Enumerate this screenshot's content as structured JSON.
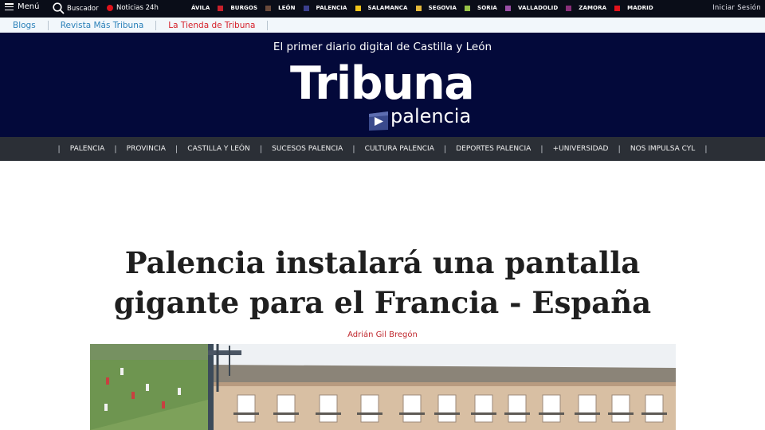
{
  "topbar": {
    "menu_label": "Menú",
    "search_label": "Buscador",
    "news24_label": "Noticias 24h",
    "login_label": "Iniciar Sesión",
    "cities": [
      {
        "label": "ÁVILA",
        "color": "#c8202b"
      },
      {
        "label": "BURGOS",
        "color": "#6a4a3a"
      },
      {
        "label": "LEÓN",
        "color": "#3b3f8f"
      },
      {
        "label": "PALENCIA",
        "color": "#f0c419"
      },
      {
        "label": "SALAMANCA",
        "color": "#e5b93a"
      },
      {
        "label": "SEGOVIA",
        "color": "#97c247"
      },
      {
        "label": "SORIA",
        "color": "#9a4fa6"
      },
      {
        "label": "VALLADOLID",
        "color": "#8a2f7a"
      },
      {
        "label": "ZAMORA",
        "color": "#e2121b"
      },
      {
        "label": "MADRID",
        "color": ""
      }
    ]
  },
  "subbar": {
    "links": [
      "Blogs",
      "Revista Más Tribuna",
      "La Tienda de Tribuna"
    ]
  },
  "header": {
    "tagline": "El primer diario digital de Castilla y León",
    "logo_main": "Tribuna",
    "logo_sub": "palencia"
  },
  "nav": {
    "items": [
      "PALENCIA",
      "PROVINCIA",
      "CASTILLA Y LEÓN",
      "SUCESOS PALENCIA",
      "CULTURA PALENCIA",
      "DEPORTES PALENCIA",
      "+UNIVERSIDAD",
      "NOS IMPULSA CYL"
    ]
  },
  "article": {
    "headline_line1": "Palencia instalará una pantalla",
    "headline_line2": "gigante para el Francia - España",
    "author": "Adrián Gil Bregón"
  },
  "colors": {
    "header_bg": "#03093a",
    "nav_bg": "#2b2f36",
    "accent_red": "#c0282e",
    "link_blue": "#2a80b9"
  }
}
